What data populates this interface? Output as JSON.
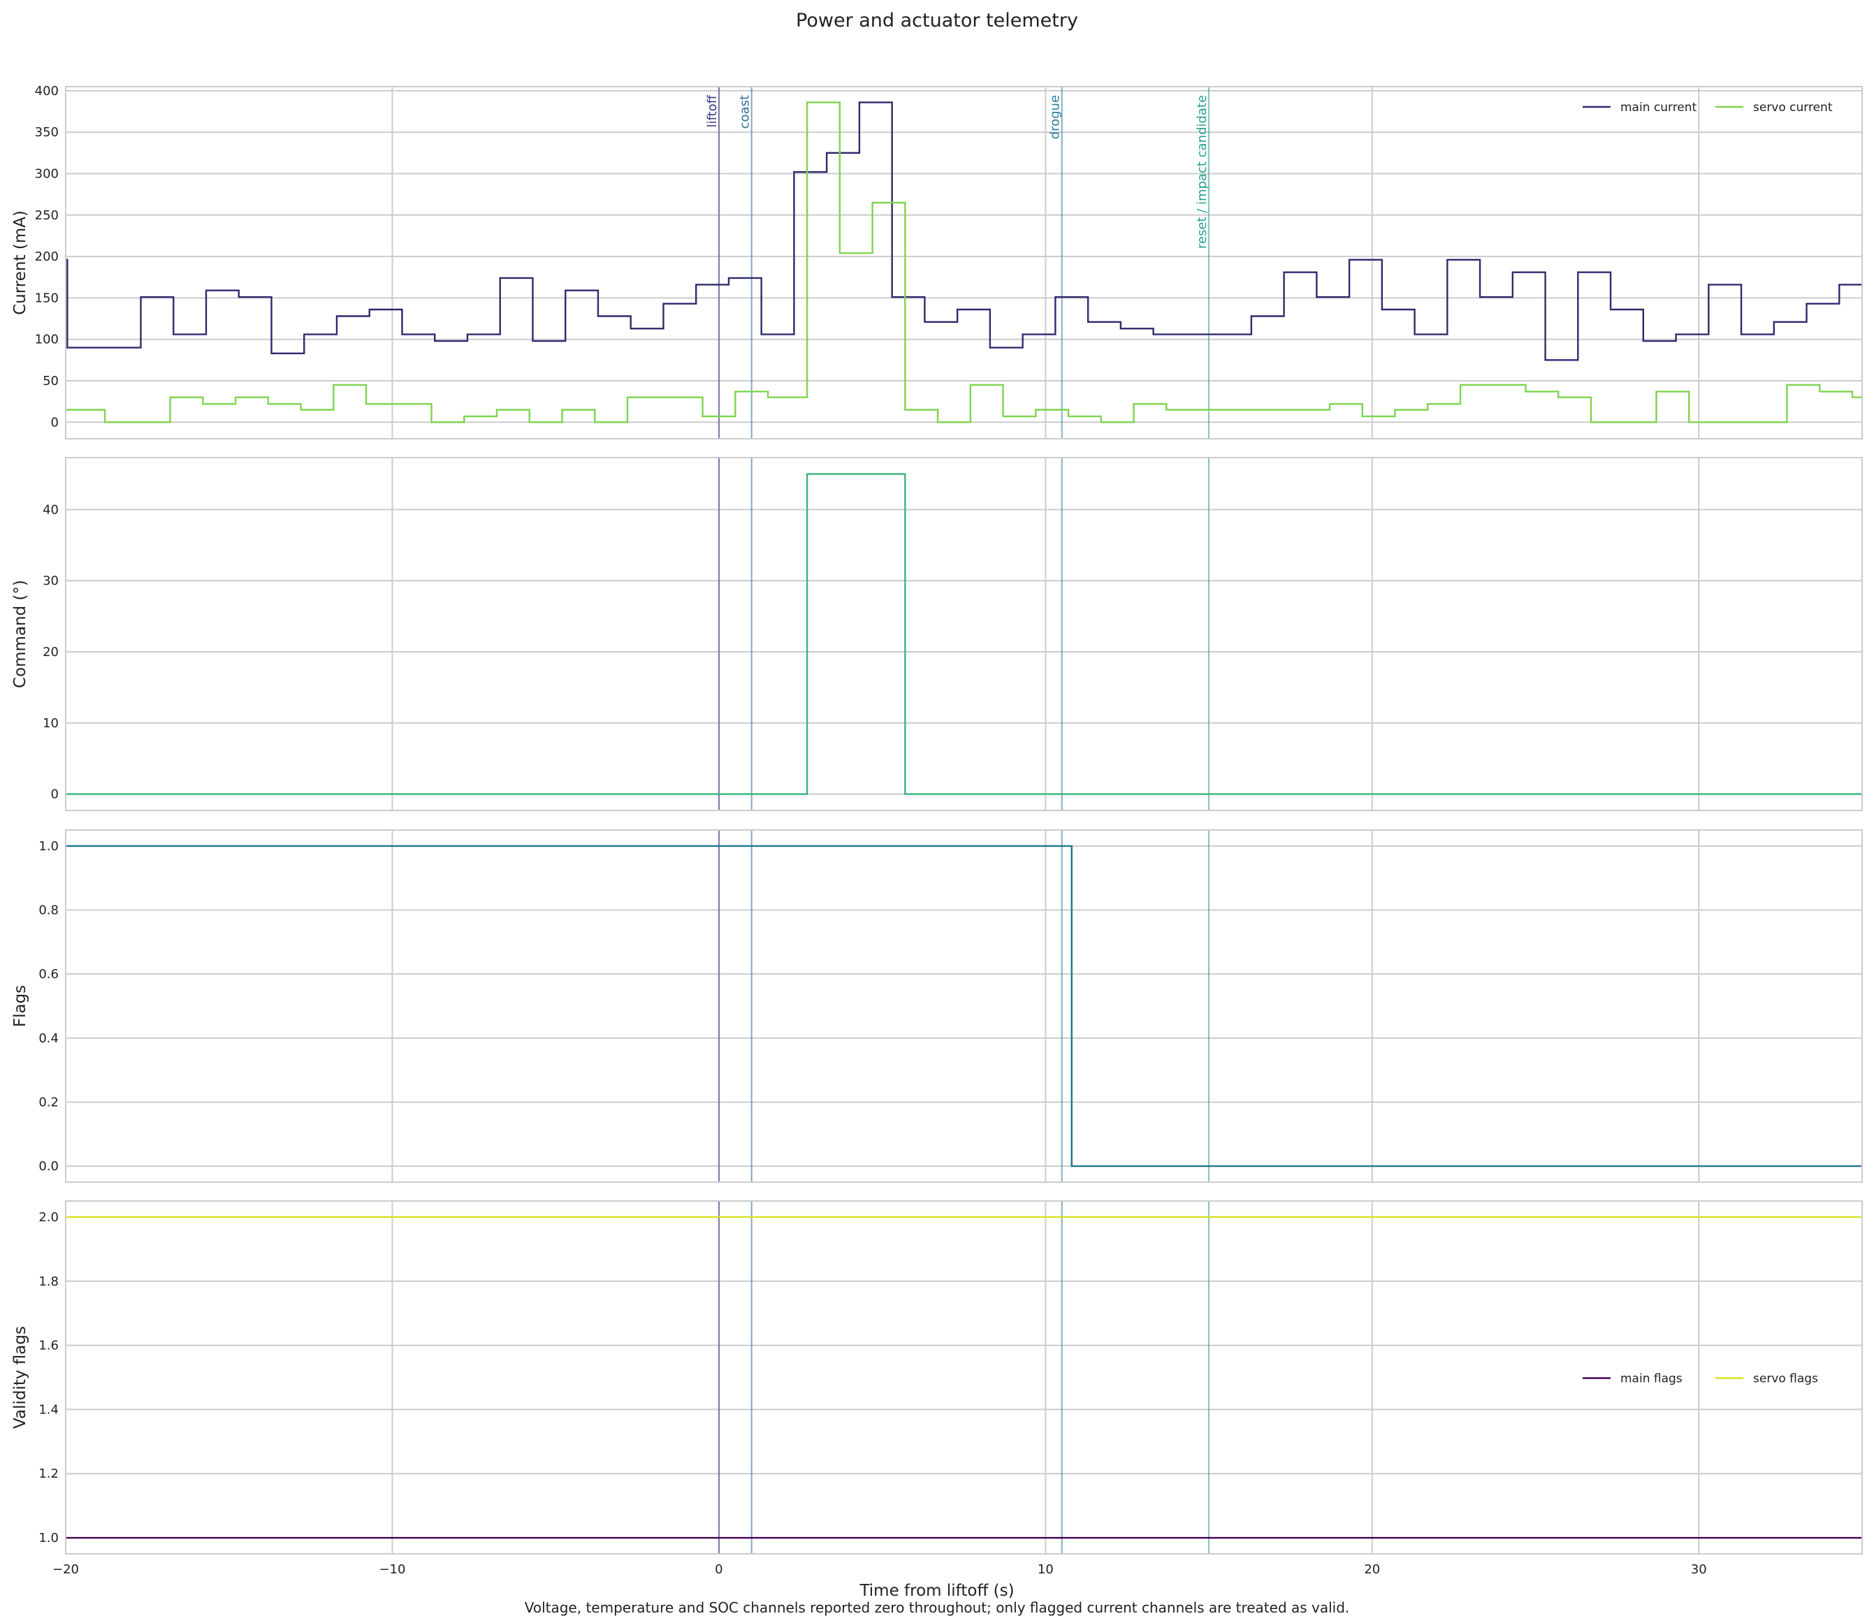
{
  "figure": {
    "title": "Power and actuator telemetry",
    "footnote": "Voltage, temperature and SOC channels reported zero throughout; only flagged current channels are treated as valid."
  },
  "colors": {
    "main_current": "#2e2a6e",
    "servo_current": "#7fd34e",
    "command": "#35b779",
    "flags": "#21768c",
    "main_flags": "#440154",
    "servo_flags": "#d8e219",
    "grid": "#cccccc",
    "frame": "#cccccc"
  },
  "chart_data": {
    "type": "line",
    "drawstyle": "steps-post",
    "xlabel": "Time from liftoff (s)",
    "xlim": [
      -20,
      35
    ],
    "xticks": [
      -20,
      -10,
      0,
      10,
      20,
      30
    ],
    "xtick_labels": [
      "−20",
      "−10",
      "0",
      "10",
      "20",
      "30"
    ],
    "grid": true,
    "events": [
      {
        "t": 0,
        "label": "liftoff",
        "color": "#3b3b8f"
      },
      {
        "t": 1,
        "label": "coast",
        "color": "#2e6f96"
      },
      {
        "t": 10.5,
        "label": "drogue",
        "color": "#2a7f9e"
      },
      {
        "t": 15,
        "label": "reset / impact candidate",
        "color": "#25a08c"
      }
    ],
    "x": [
      -20,
      -19,
      -18,
      -17,
      -16,
      -15,
      -14,
      -13,
      -12,
      -11,
      -10,
      -9,
      -8,
      -7,
      -6,
      -5,
      -4,
      -3,
      -2,
      -1,
      0,
      1,
      2,
      3,
      4,
      5,
      6,
      7,
      8,
      9,
      10,
      11,
      12,
      13,
      14,
      15,
      16,
      17,
      18,
      19,
      20,
      21,
      22,
      23,
      24,
      25,
      26,
      27,
      28,
      29,
      30,
      31,
      32,
      33,
      34,
      35
    ],
    "panels": [
      {
        "ylabel": "Current (mA)",
        "ylim": [
          -20,
          405
        ],
        "yticks": [
          0,
          50,
          100,
          150,
          200,
          250,
          300,
          350,
          400
        ],
        "legend": "top-right",
        "series": [
          {
            "name": "main current",
            "color": "#2e2a6e",
            "xs": [
              -20,
              -19.95,
              -17.7,
              -16.7,
              -15.7,
              -14.7,
              -13.7,
              -12.7,
              -11.7,
              -10.7,
              -9.7,
              -8.7,
              -7.7,
              -6.7,
              -5.7,
              -4.7,
              -3.7,
              -2.7,
              -1.7,
              -0.7,
              0.3,
              1.3,
              2.3,
              3.3,
              4.3,
              5.3,
              6.3,
              7.3,
              8.3,
              9.3,
              10.3,
              11.3,
              12.3,
              13.3,
              14.3,
              15.3,
              16.3,
              17.3,
              18.3,
              19.3,
              20.3,
              21.3,
              22.3,
              23.3,
              24.3,
              25.3,
              26.3,
              27.3,
              28.3,
              29.3,
              30.3,
              31.3,
              32.3,
              33.3,
              34.3,
              35
            ],
            "values": [
              196,
              90,
              151,
              106,
              159,
              151,
              83,
              106,
              128,
              136,
              106,
              98,
              106,
              174,
              98,
              159,
              128,
              113,
              143,
              166,
              174,
              106,
              302,
              325,
              386,
              151,
              121,
              136,
              90,
              106,
              151,
              121,
              113,
              106,
              106,
              106,
              128,
              181,
              151,
              196,
              136,
              106,
              196,
              151,
              181,
              75,
              181,
              136,
              98,
              106,
              166,
              106,
              121,
              143,
              166,
              166
            ]
          },
          {
            "name": "servo current",
            "color": "#7fd34e",
            "xs": [
              -20,
              -18.8,
              -16.8,
              -15.8,
              -14.8,
              -13.8,
              -12.8,
              -11.8,
              -10.8,
              -9.8,
              -8.8,
              -7.8,
              -6.8,
              -5.8,
              -4.8,
              -3.8,
              -2.8,
              -1.8,
              -0.5,
              0.5,
              1.5,
              2.7,
              3.7,
              4.7,
              5.7,
              6.7,
              7.7,
              8.7,
              9.7,
              10.7,
              11.7,
              12.7,
              13.7,
              14.7,
              15.7,
              16.7,
              17.7,
              18.7,
              19.7,
              20.7,
              21.7,
              22.7,
              23.7,
              24.7,
              25.7,
              26.7,
              27.7,
              28.7,
              29.7,
              30.7,
              31.7,
              32.7,
              33.7,
              34.7,
              35
            ],
            "values": [
              15,
              0,
              30,
              22,
              30,
              22,
              15,
              45,
              22,
              22,
              0,
              7,
              15,
              0,
              15,
              0,
              30,
              30,
              7,
              37,
              30,
              386,
              204,
              265,
              15,
              0,
              45,
              7,
              15,
              7,
              0,
              22,
              15,
              15,
              15,
              15,
              15,
              22,
              7,
              15,
              22,
              45,
              45,
              37,
              30,
              0,
              0,
              37,
              0,
              0,
              0,
              45,
              37,
              30,
              30
            ]
          }
        ]
      },
      {
        "ylabel": "Command (°)",
        "ylim": [
          -2.3,
          47.3
        ],
        "yticks": [
          0,
          10,
          20,
          30,
          40
        ],
        "series": [
          {
            "name": "",
            "color": "#35b779",
            "xs": [
              -20,
              2.7,
              5.7,
              35
            ],
            "values": [
              0,
              45,
              0,
              0
            ]
          }
        ]
      },
      {
        "ylabel": "Flags",
        "ylim": [
          -0.05,
          1.05
        ],
        "yticks": [
          0.0,
          0.2,
          0.4,
          0.6,
          0.8,
          1.0
        ],
        "ytick_labels": [
          "0.0",
          "0.2",
          "0.4",
          "0.6",
          "0.8",
          "1.0"
        ],
        "series": [
          {
            "name": "",
            "color": "#21768c",
            "xs": [
              -20,
              10.8,
              35
            ],
            "values": [
              1,
              0,
              0
            ]
          }
        ]
      },
      {
        "ylabel": "Validity flags",
        "ylim": [
          0.95,
          2.05
        ],
        "yticks": [
          1.0,
          1.2,
          1.4,
          1.6,
          1.8,
          2.0
        ],
        "ytick_labels": [
          "1.0",
          "1.2",
          "1.4",
          "1.6",
          "1.8",
          "2.0"
        ],
        "legend": "center-right",
        "series": [
          {
            "name": "main flags",
            "color": "#440154",
            "xs": [
              -20,
              35
            ],
            "values": [
              1,
              1
            ]
          },
          {
            "name": "servo flags",
            "color": "#d8e219",
            "xs": [
              -20,
              35
            ],
            "values": [
              2,
              2
            ]
          }
        ]
      }
    ]
  }
}
